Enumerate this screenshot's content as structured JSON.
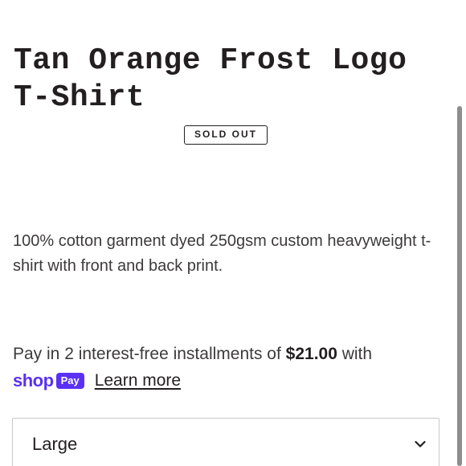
{
  "product": {
    "title": "Tan Orange Frost Logo T-Shirt",
    "badge": "SOLD OUT",
    "description": "100% cotton garment dyed 250gsm custom heavyweight t-shirt with front and back print."
  },
  "payment": {
    "installments_prefix": "Pay in 2 interest-free installments of ",
    "amount": "$21.00",
    "installments_suffix": " with",
    "shop_word": "shop",
    "pay_badge": "Pay",
    "learn_more": "Learn more",
    "brand_color": "#5a31f4"
  },
  "size_select": {
    "selected": "Large",
    "icon": "chevron-down-icon"
  }
}
